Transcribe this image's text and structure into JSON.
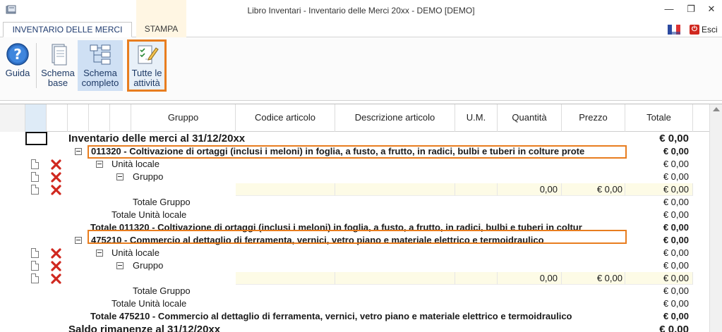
{
  "window": {
    "title": "Libro Inventari - Inventario delle Merci  20xx - DEMO [DEMO]"
  },
  "tabs": [
    {
      "label": "INVENTARIO DELLE MERCI"
    },
    {
      "label": "STAMPA"
    }
  ],
  "toolbar_right": {
    "esci_label": "Esci"
  },
  "ribbon": {
    "guida": "Guida",
    "schema_base_1": "Schema",
    "schema_base_2": "base",
    "schema_completo_1": "Schema",
    "schema_completo_2": "completo",
    "tutte_1": "Tutte le",
    "tutte_2": "attività"
  },
  "grid": {
    "columns": [
      "Gruppo",
      "Codice articolo",
      "Descrizione articolo",
      "U.M.",
      "Quantità",
      "Prezzo",
      "Totale"
    ],
    "rows": [
      {
        "text": "Inventario delle merci al 31/12/20xx",
        "total": "€ 0,00"
      },
      {
        "text": "011320 - Coltivazione di ortaggi (inclusi i meloni) in foglia, a fusto, a frutto, in radici, bulbi e tuberi in colture prote",
        "total": "€ 0,00"
      },
      {
        "text": "Unità locale",
        "total": "€ 0,00"
      },
      {
        "text": "Gruppo",
        "total": "€ 0,00"
      },
      {
        "quantita": "0,00",
        "prezzo": "€ 0,00",
        "total": "€ 0,00"
      },
      {
        "text": "Totale Gruppo",
        "total": "€ 0,00"
      },
      {
        "text": "Totale Unità locale",
        "total": "€ 0,00"
      },
      {
        "text": "Totale 011320 - Coltivazione di ortaggi (inclusi i meloni) in foglia, a fusto, a frutto, in radici, bulbi e tuberi in coltur",
        "total": "€ 0,00"
      },
      {
        "text": "475210 - Commercio al dettaglio di ferramenta, vernici, vetro piano e materiale elettrico e termoidraulico",
        "total": "€ 0,00"
      },
      {
        "text": "Unità locale",
        "total": "€ 0,00"
      },
      {
        "text": "Gruppo",
        "total": "€ 0,00"
      },
      {
        "quantita": "0,00",
        "prezzo": "€ 0,00",
        "total": "€ 0,00"
      },
      {
        "text": "Totale Gruppo",
        "total": "€ 0,00"
      },
      {
        "text": "Totale Unità locale",
        "total": "€ 0,00"
      },
      {
        "text": "Totale 475210 - Commercio al dettaglio di ferramenta, vernici, vetro piano e materiale elettrico e termoidraulico",
        "total": "€ 0,00"
      },
      {
        "text": "Saldo rimanenze al 31/12/20xx",
        "total": "€ 0,00"
      }
    ]
  },
  "colors": {
    "accent_orange": "#e87d1f",
    "delete_red": "#d0281f",
    "selected_blue": "#cfe0f4"
  }
}
